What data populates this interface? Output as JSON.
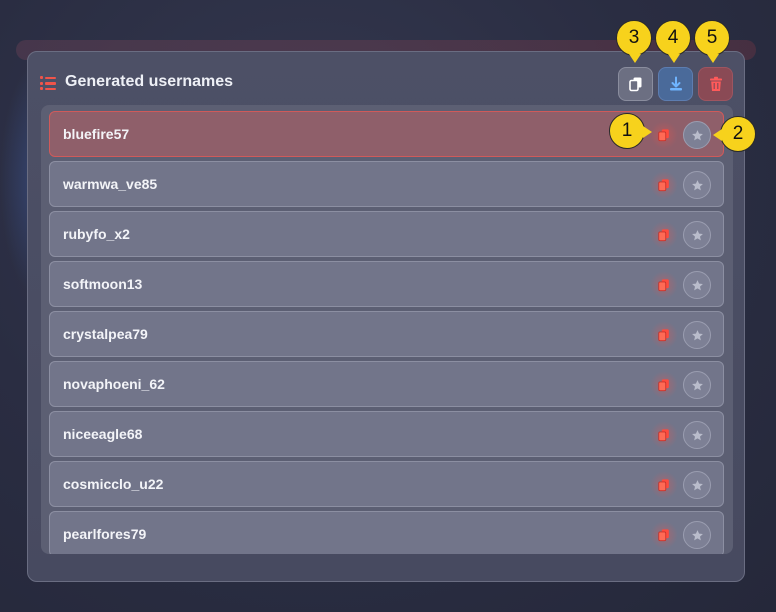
{
  "panel": {
    "title": "Generated usernames",
    "actions": [
      {
        "name": "copy-all-button",
        "icon": "copy-icon"
      },
      {
        "name": "download-button",
        "icon": "download-icon"
      },
      {
        "name": "delete-all-button",
        "icon": "trash-icon"
      }
    ]
  },
  "usernames": [
    {
      "label": "bluefire57",
      "selected": true
    },
    {
      "label": "warmwa_ve85",
      "selected": false
    },
    {
      "label": "rubyfo_x2",
      "selected": false
    },
    {
      "label": "softmoon13",
      "selected": false
    },
    {
      "label": "crystalpea79",
      "selected": false
    },
    {
      "label": "novaphoeni_62",
      "selected": false
    },
    {
      "label": "niceeagle68",
      "selected": false
    },
    {
      "label": "cosmicclo_u22",
      "selected": false
    },
    {
      "label": "pearlfores79",
      "selected": false
    }
  ],
  "annotations": [
    "1",
    "2",
    "3",
    "4",
    "5"
  ],
  "colors": {
    "accent": "#f0544a",
    "download": "#5aa0e6",
    "badge": "#f7d21c"
  }
}
